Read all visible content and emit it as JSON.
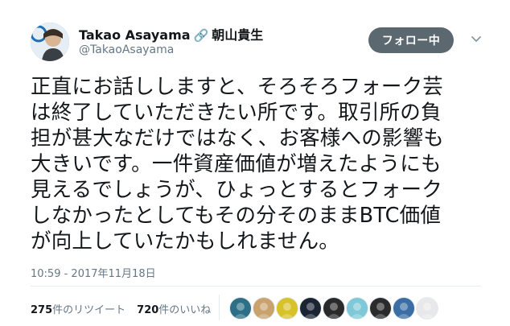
{
  "author": {
    "display_name": "Takao Asayama",
    "link_icon": "link-icon",
    "kanji_name": "朝山貴生",
    "handle": "@TakaoAsayama"
  },
  "follow_button": {
    "label": "フォロー中"
  },
  "menu_icon": "chevron-down-icon",
  "tweet": {
    "lines": [
      "正直にお話ししますと、そろそろフォーク芸",
      "は終了していただきたい所です。取引所の負",
      "担が甚大なだけではなく、お客様への影響も",
      "大きいです。一件資産価値が増えたようにも",
      "見えるでしょうが、ひょっとするとフォーク",
      "しなかったとしてもその分そのままBTC価値",
      "が向上していたかもしれません。"
    ],
    "timestamp": "10:59 - 2017年11月18日"
  },
  "stats": {
    "retweet_count": "275",
    "retweet_label": "件のリツイート",
    "like_count": "720",
    "like_label": "件のいいね"
  },
  "likers": [
    {
      "name": "liker-avatar-1",
      "color": "#2d6f86"
    },
    {
      "name": "liker-avatar-2",
      "color": "#c9a26e"
    },
    {
      "name": "liker-avatar-3",
      "color": "#d8c22a"
    },
    {
      "name": "liker-avatar-4",
      "color": "#1b2433"
    },
    {
      "name": "liker-avatar-5",
      "color": "#2a2a2a"
    },
    {
      "name": "liker-avatar-6",
      "color": "#7ec8d8"
    },
    {
      "name": "liker-avatar-7",
      "color": "#2b2b2b"
    },
    {
      "name": "liker-avatar-8",
      "color": "#3a6ea5"
    },
    {
      "name": "liker-avatar-9",
      "color": "#e8e8ea"
    }
  ]
}
